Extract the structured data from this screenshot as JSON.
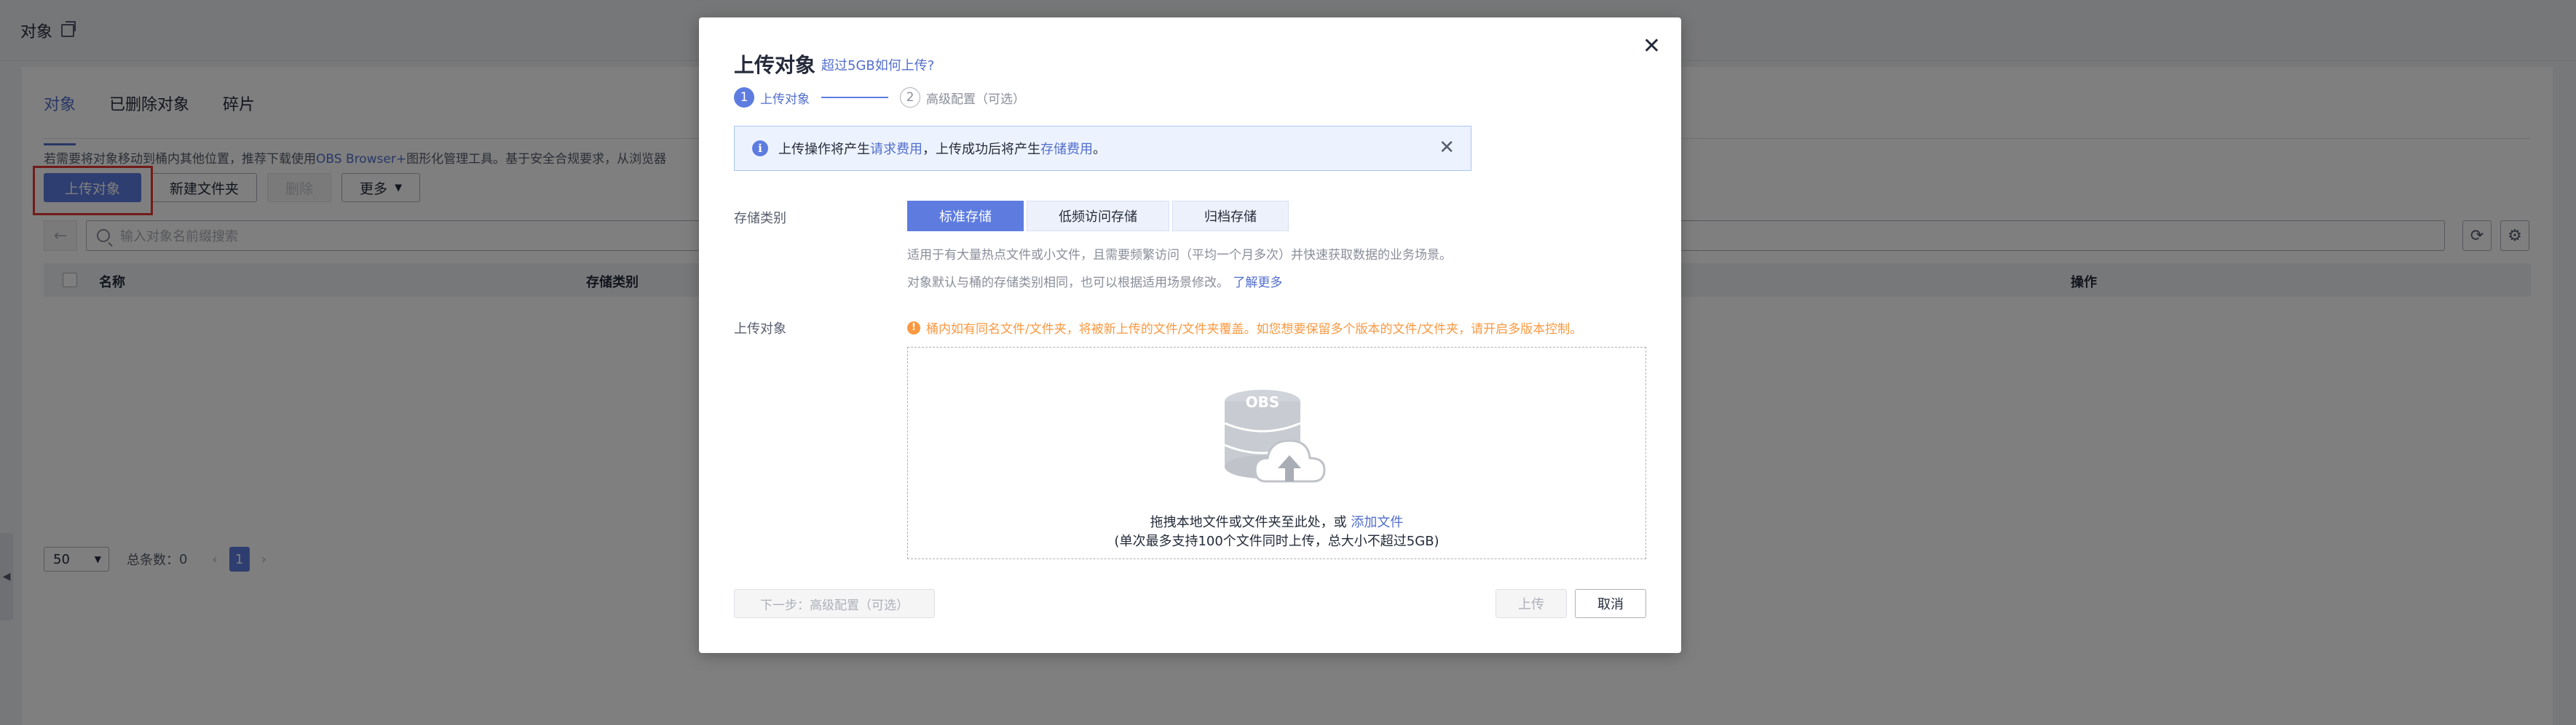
{
  "page": {
    "title": "对象",
    "tabs": [
      "对象",
      "已删除对象",
      "碎片"
    ],
    "notice_prefix": "若需要将对象移动到桶内其他位置，推荐下载使用",
    "notice_link": "OBS Browser+",
    "notice_suffix": "图形化管理工具。基于安全合规要求，从浏览器",
    "buttons": {
      "upload": "上传对象",
      "new_folder": "新建文件夹",
      "delete": "删除",
      "more": "更多"
    },
    "search_placeholder": "输入对象名前缀搜索",
    "table_headers": [
      "名称",
      "存储类别",
      "操作"
    ],
    "pager": {
      "page_size": "50",
      "total_label": "总条数：",
      "total": "0",
      "current_page": "1"
    }
  },
  "modal": {
    "title": "上传对象",
    "title_link": "超过5GB如何上传?",
    "steps": [
      {
        "num": "1",
        "label": "上传对象"
      },
      {
        "num": "2",
        "label": "高级配置（可选）"
      }
    ],
    "info": {
      "text_a": "上传操作将产生",
      "link_a": "请求费用",
      "text_b": "，上传成功后将产生",
      "link_b": "存储费用",
      "text_c": "。"
    },
    "storage_label": "存储类别",
    "storage_options": [
      "标准存储",
      "低频访问存储",
      "归档存储"
    ],
    "selected_storage": "标准存储",
    "storage_desc1": "适用于有大量热点文件或小文件，且需要频繁访问（平均一个月多次）并快速获取数据的业务场景。",
    "storage_desc2": "对象默认与桶的存储类别相同，也可以根据适用场景修改。",
    "storage_desc_link": "了解更多",
    "upload_label": "上传对象",
    "warning": "桶内如有同名文件/文件夹，将被新上传的文件/文件夹覆盖。如您想要保留多个版本的文件/文件夹，请开启多版本控制。",
    "drop_icon_text": "OBS",
    "drop_text": "拖拽本地文件或文件夹至此处，或",
    "drop_link": "添加文件",
    "drop_hint": "(单次最多支持100个文件同时上传，总大小不超过5GB)",
    "next_button": "下一步：高级配置（可选）",
    "upload_button": "上传",
    "cancel_button": "取消"
  },
  "colors": {
    "primary": "#5e7ce0",
    "link": "#526ecc",
    "warning": "#fa9841",
    "highlight_box": "#e53935"
  }
}
